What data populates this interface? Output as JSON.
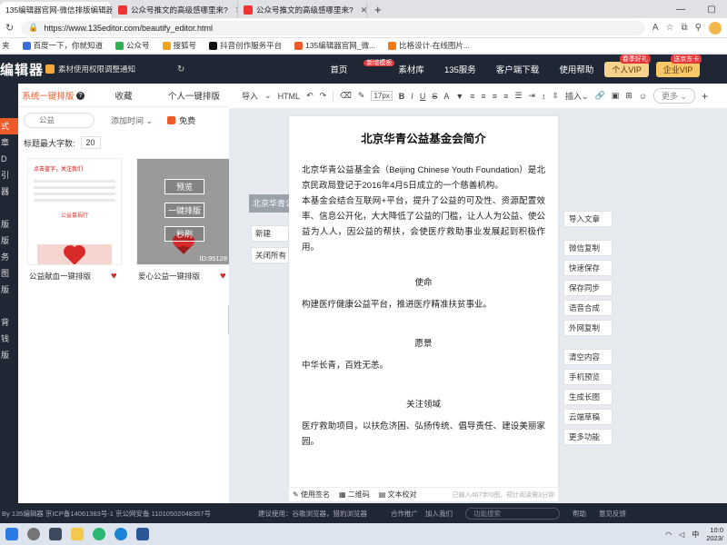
{
  "browser": {
    "tabs": [
      {
        "label": "135编辑器官网-微信排版编辑器",
        "active": true
      },
      {
        "label": "公众号推文的高级感哪里来?",
        "active": false
      },
      {
        "label": "公众号推文的高级感哪里来?",
        "active": false
      }
    ],
    "url": "https://www.135editor.com/beautify_editor.html",
    "bookmarks": [
      "夹",
      "百度一下，你就知道",
      "公众号",
      "搜狐号",
      "抖音创作服务平台",
      "135编辑器官网_微...",
      "比格设计-在线图片..."
    ]
  },
  "header": {
    "logo": "编辑器",
    "notice": "素材使用权限调整通知",
    "nav": [
      {
        "label": "首页",
        "badge": ""
      },
      {
        "label": "素材库",
        "badge": "新增模板"
      },
      {
        "label": "135服务",
        "badge": ""
      },
      {
        "label": "客户端下载",
        "badge": ""
      },
      {
        "label": "使用帮助",
        "badge": ""
      }
    ],
    "vip_personal": "个人VIP",
    "vip_personal_badge": "春季好礼",
    "vip_enterprise": "企业VIP",
    "vip_enterprise_badge": "送京东卡"
  },
  "leftmenu": [
    "式",
    "章",
    "D",
    "引",
    "器",
    "",
    "版",
    "版",
    "务",
    "图",
    "版",
    "",
    "背",
    "钱",
    "版"
  ],
  "panel": {
    "tabs": [
      "系统一键排版",
      "收藏",
      "个人一键排版"
    ],
    "search_placeholder": "公益",
    "sort_label": "添加时间",
    "free_label": "免费",
    "title_len_label": "标题最大字数:",
    "title_len_value": "20",
    "cards": [
      {
        "name": "公益献血一键排版",
        "cap1": "点击蓝字，关注我们",
        "org": "公益募捐行",
        "id": ""
      },
      {
        "name": "爱心公益一键排版",
        "id": "ID:95128"
      }
    ],
    "hover_buttons": [
      "预览",
      "一键排版",
      "秒刷"
    ]
  },
  "toolbar": {
    "import": "导入",
    "html": "HTML",
    "font_size": "17px",
    "more": "更多"
  },
  "editor": {
    "side_tag": "北京华青公",
    "left_actions": [
      "新建",
      "关闭所有"
    ],
    "title": "北京华青公益基金会简介",
    "intro1": "北京华青公益基金会（Beijing Chinese Youth Foundation）是北京民政局登记于2016年4月5日成立的一个慈善机构。",
    "intro2": "本基金会结合互联网+平台，提升了公益的可及性、资源配置效率、信息公开化，大大降低了公益的门槛，让人人为公益、使公益为人人，因公益的帮扶，会使医疗救助事业发展起到积极作用。",
    "sections": [
      {
        "heading": "使命",
        "body": "构建医疗健康公益平台，推进医疗精准扶贫事业。"
      },
      {
        "heading": "愿景",
        "body": "中华长青，百姓无恙。"
      },
      {
        "heading": "关注领域",
        "body": "医疗救助项目，以扶危济困、弘扬传统、倡导责任、建设美丽家园。"
      }
    ],
    "status": [
      "使用签名",
      "二维码",
      "文本校对"
    ],
    "count": "已输入467字/0图，预计阅读需3分钟"
  },
  "right_actions": [
    "导入文章",
    "微信复制",
    "快速保存",
    "保存同步",
    "语音合成",
    "外网复制",
    "清空内容",
    "手机预览",
    "生成长图",
    "云端草稿",
    "更多功能"
  ],
  "footer": {
    "left": "By 135编辑器  京ICP备14061383号-1  京公网安备 11010502048357号",
    "mid": "建议使用：谷歌浏览器，猎豹浏览器",
    "links": [
      "合作推广",
      "加入我们"
    ],
    "search_placeholder": "功能搜索",
    "tail": [
      "帮助",
      "意见反馈"
    ]
  },
  "taskbar": {
    "ime": "中",
    "time": "10:0",
    "date": "2023/"
  }
}
